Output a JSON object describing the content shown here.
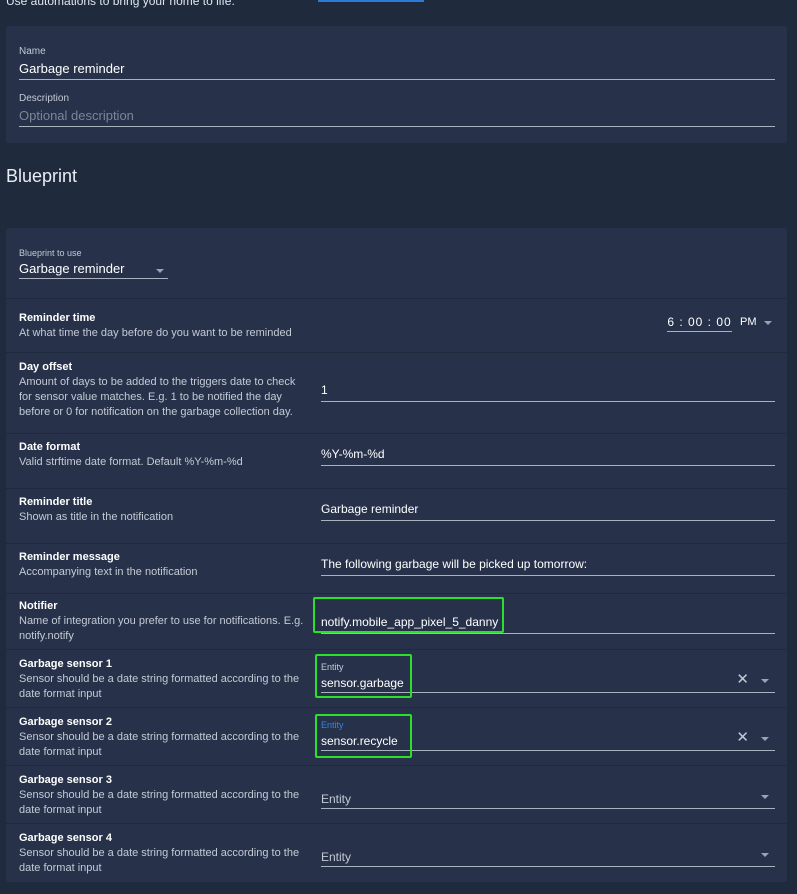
{
  "header": {
    "intro_text": "Use automations to bring your home to life."
  },
  "details": {
    "name_label": "Name",
    "name_value": "Garbage reminder",
    "description_label": "Description",
    "description_placeholder": "Optional description"
  },
  "blueprint_section": {
    "title": "Blueprint",
    "select_label": "Blueprint to use",
    "select_value": "Garbage reminder"
  },
  "inputs": {
    "reminder_time": {
      "name": "Reminder time",
      "description": "At what time the day before do you want to be reminded",
      "value": "6 : 00 : 00",
      "ampm": "PM"
    },
    "day_offset": {
      "name": "Day offset",
      "description": "Amount of days to be added to the triggers date to check for sensor value matches. E.g. 1 to be notified the day before or 0 for notification on the garbage collection day.",
      "value": "1"
    },
    "date_format": {
      "name": "Date format",
      "description": "Valid strftime date format. Default %Y-%m-%d",
      "value": "%Y-%m-%d"
    },
    "reminder_title": {
      "name": "Reminder title",
      "description": "Shown as title in the notification",
      "value": "Garbage reminder"
    },
    "reminder_message": {
      "name": "Reminder message",
      "description": "Accompanying text in the notification",
      "value": "The following garbage will be picked up tomorrow:"
    },
    "notifier": {
      "name": "Notifier",
      "description": "Name of integration you prefer to use for notifications. E.g. notify.notify",
      "value": "notify.mobile_app_pixel_5_danny"
    },
    "garbage_sensor_1": {
      "name": "Garbage sensor 1",
      "description": "Sensor should be a date string formatted according to the date format input",
      "label": "Entity",
      "value": "sensor.garbage"
    },
    "garbage_sensor_2": {
      "name": "Garbage sensor 2",
      "description": "Sensor should be a date string formatted according to the date format input",
      "label": "Entity",
      "value": "sensor.recycle"
    },
    "garbage_sensor_3": {
      "name": "Garbage sensor 3",
      "description": "Sensor should be a date string formatted according to the date format input",
      "placeholder": "Entity"
    },
    "garbage_sensor_4": {
      "name": "Garbage sensor 4",
      "description": "Sensor should be a date string formatted according to the date format input",
      "placeholder": "Entity"
    }
  },
  "icons": {
    "clear": "close-icon",
    "dropdown": "chevron-down-icon"
  },
  "colors": {
    "background": "#1f2a3d",
    "card": "#27324a",
    "highlight": "#2be02b",
    "focus_label": "#2f86e6"
  }
}
